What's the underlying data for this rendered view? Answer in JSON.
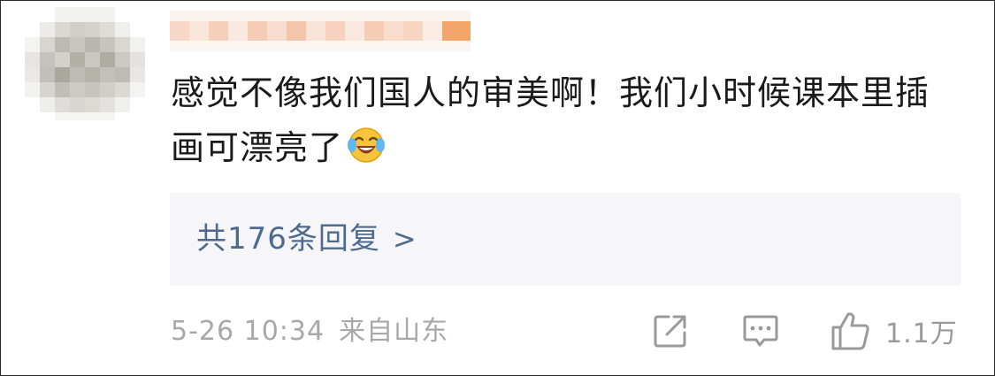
{
  "comment": {
    "text": "感觉不像我们国人的审美啊！我们小时候课本里插画可漂亮了",
    "emoji": "laughing-crying-emoji"
  },
  "replies": {
    "label": "共176条回复",
    "chevron": ">"
  },
  "footer": {
    "date": "5-26 10:34",
    "location": "来自山东",
    "like_count": "1.1万"
  },
  "icons": {
    "share": "share-icon",
    "reply": "comment-icon",
    "like": "thumbs-up-icon"
  },
  "colors": {
    "link": "#4e6b8f",
    "meta": "#a8a8a8",
    "reply_box_bg": "#f6f6f8"
  }
}
